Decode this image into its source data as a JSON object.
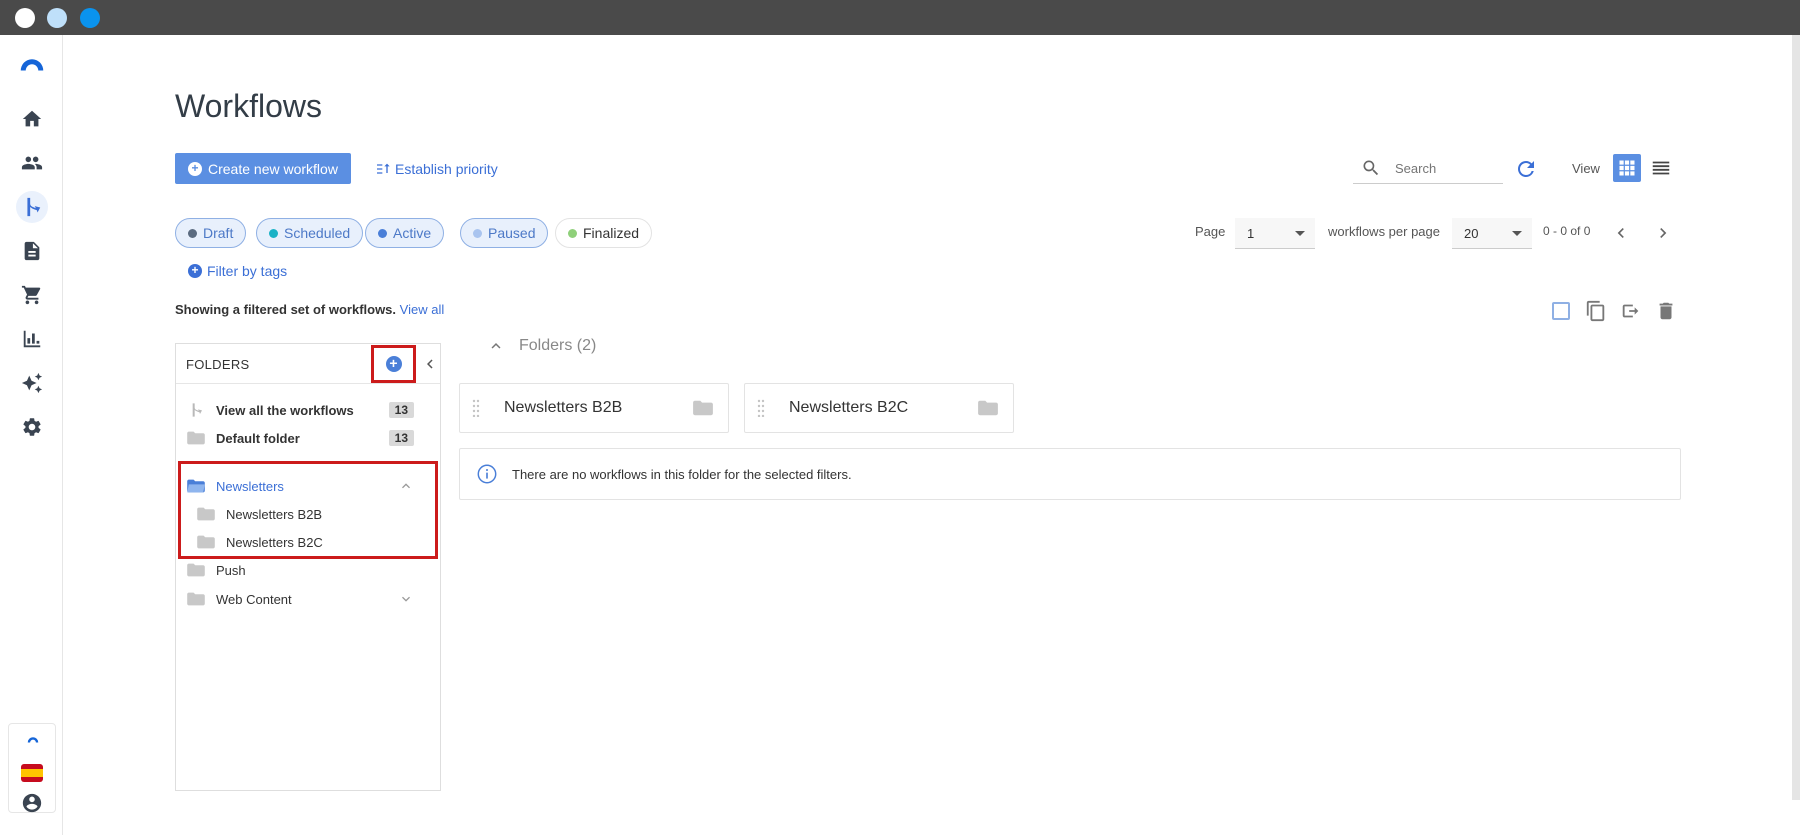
{
  "main": {
    "title": "Workflows",
    "create_button": "Create new workflow",
    "priority_link": "Establish priority",
    "search_placeholder": "Search",
    "view_label": "View",
    "filters": [
      {
        "label": "Draft",
        "color": "#5b6b80"
      },
      {
        "label": "Scheduled",
        "color": "#1ab2c6"
      },
      {
        "label": "Active",
        "color": "#4a7fd8"
      },
      {
        "label": "Paused",
        "color": "#a9c4ef"
      },
      {
        "label": "Finalized",
        "color": "#8fd07a"
      }
    ],
    "pager": {
      "page_label": "Page",
      "page_value": "1",
      "per_page_label": "workflows per page",
      "per_page_value": "20",
      "range": "0 - 0 of 0"
    },
    "filter_tags": "Filter by tags",
    "showing_text": "Showing a filtered set of workflows.",
    "view_all": "View all"
  },
  "folders": {
    "title": "FOLDERS",
    "items": [
      {
        "label": "View all the workflows",
        "count": "13"
      },
      {
        "label": "Default folder",
        "count": "13"
      },
      {
        "label": "Newsletters"
      },
      {
        "label": "Newsletters B2B"
      },
      {
        "label": "Newsletters B2C"
      },
      {
        "label": "Push"
      },
      {
        "label": "Web Content"
      }
    ]
  },
  "content": {
    "folders_header": "Folders (2)",
    "cards": [
      "Newsletters B2B",
      "Newsletters B2C"
    ],
    "info": "There are no workflows in this folder for the selected filters."
  },
  "colors": {
    "accent": "#5b8fe2",
    "link": "#3b6fd6",
    "highlight": "#cc1b1b"
  }
}
